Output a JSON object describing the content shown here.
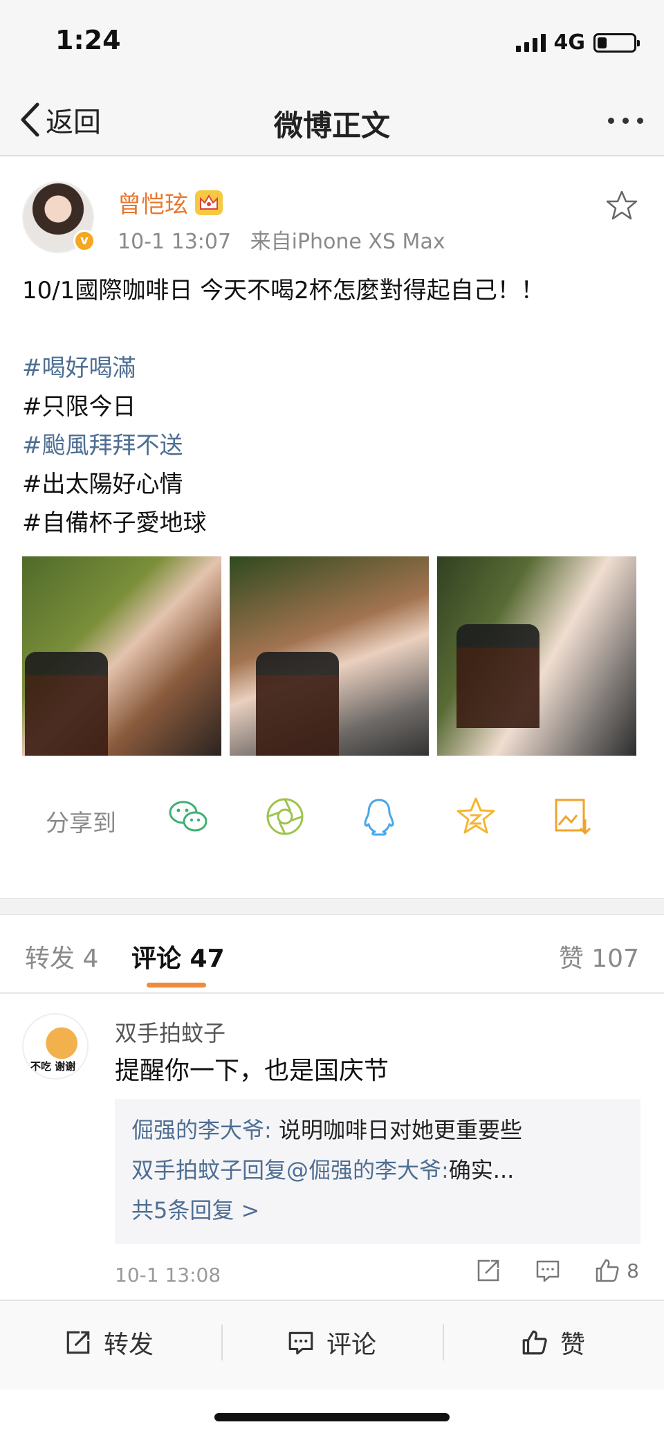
{
  "status_bar": {
    "time": "1:24",
    "network": "4G",
    "battery_level": 0.25
  },
  "nav": {
    "back_label": "返回",
    "title": "微博正文"
  },
  "post": {
    "author": "曾恺玹",
    "time": "10-1 13:07",
    "source": "来自iPhone XS Max",
    "text": "10/1國際咖啡日 今天不喝2杯怎麼對得起自己！！",
    "tags": [
      {
        "text": "#喝好喝滿"
      },
      {
        "text": "#只限今日"
      },
      {
        "text": "#颱風拜拜不送"
      },
      {
        "text": "#出太陽好心情"
      },
      {
        "text": "#自備杯子愛地球"
      }
    ],
    "photo_count": 3
  },
  "share": {
    "label": "分享到",
    "targets": [
      "wechat-icon",
      "moments-icon",
      "qq-icon",
      "qzone-icon",
      "save-image-icon"
    ]
  },
  "tabs": {
    "repost": "转发 4",
    "comment": "评论 47",
    "like": "赞 107"
  },
  "comment": {
    "name": "双手拍蚊子",
    "avatar_caption": "不吃 谢谢",
    "text": "提醒你一下，也是国庆节",
    "replies": [
      {
        "user": "倔强的李大爷:",
        "text": " 说明咖啡日对她更重要些"
      },
      {
        "user": "双手拍蚊子回复@倔强的李大爷:",
        "text": "确实..."
      }
    ],
    "more_replies": "共5条回复 >",
    "time": "10-1 13:08",
    "like_count": "8"
  },
  "toolbar": {
    "repost": "转发",
    "comment": "评论",
    "like": "赞"
  },
  "colors": {
    "accent": "#f08a3c",
    "link": "#4e6e93",
    "author": "#e8772e"
  }
}
